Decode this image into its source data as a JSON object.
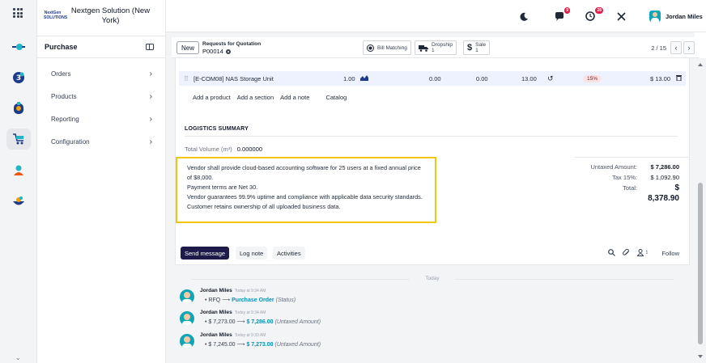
{
  "company": {
    "name": "Nextgen Solution (New York)",
    "logo_text": "NextGen SOLUTIONS"
  },
  "rail": {
    "apps": [
      {
        "name": "discuss-app-icon"
      },
      {
        "name": "todo-app-icon"
      },
      {
        "name": "contacts-app-icon"
      },
      {
        "name": "purchase-app-icon"
      },
      {
        "name": "crm-app-icon"
      },
      {
        "name": "sales-app-icon"
      }
    ],
    "more": "⌄"
  },
  "sidebar": {
    "title": "Purchase",
    "items": [
      {
        "label": "Orders"
      },
      {
        "label": "Products"
      },
      {
        "label": "Reporting"
      },
      {
        "label": "Configuration"
      }
    ]
  },
  "topbar": {
    "chat_count": "9",
    "activity_count": "28",
    "user_name": "Jordan Miles"
  },
  "control": {
    "new_label": "New",
    "breadcrumb_parent": "Requests for Quotation",
    "record_name": "P00014",
    "smart_buttons": [
      {
        "icon": "bill-matching-icon",
        "label": "Bill Matching",
        "value": ""
      },
      {
        "icon": "truck-icon",
        "label": "Dropship",
        "value": "1"
      },
      {
        "icon": "dollar-icon",
        "label": "Sale",
        "value": "1"
      }
    ],
    "pager": "2 / 15"
  },
  "order_line": {
    "product": "[E-COM08] NAS Storage Unit",
    "quantity": "1.00",
    "col_a": "0.00",
    "col_b": "0.00",
    "unit_price": "13.00",
    "tax": "15%",
    "subtotal": "$ 13.00"
  },
  "line_actions": [
    "Add a product",
    "Add a section",
    "Add a note",
    "Catalog"
  ],
  "logistics": {
    "title": "LOGISTICS SUMMARY",
    "volume_label": "Total Volume (m³)",
    "volume_value": "0.000000"
  },
  "notes": [
    "Vendor shall provide cloud-based accounting software for 25 users at a fixed annual price of $8,000.",
    "Payment terms are Net 30.",
    "Vendor guarantees 99.9% uptime and compliance with applicable data security standards.",
    "Customer retains ownership of all uploaded business data."
  ],
  "totals": {
    "untaxed_label": "Untaxed Amount:",
    "untaxed_value": "$ 7,286.00",
    "tax_label": "Tax 15%:",
    "tax_value": "$ 1,092.90",
    "total_label": "Total:",
    "total_value": "$ 8,378.90"
  },
  "chatter": {
    "send_message": "Send message",
    "log_note": "Log note",
    "activities": "Activities",
    "follower_count": "1",
    "follow": "Follow",
    "day_label": "Today",
    "messages": [
      {
        "author": "Jordan Miles",
        "time": "Today at 9:34 AM",
        "old": "RFQ",
        "new": "Purchase Order",
        "field": "(Status)"
      },
      {
        "author": "Jordan Miles",
        "time": "Today at 9:34 AM",
        "old": "$ 7,273.00",
        "new": "$ 7,286.00",
        "field": "(Untaxed Amount)"
      },
      {
        "author": "Jordan Miles",
        "time": "Today at 9:33 AM",
        "old": "$ 7,245.00",
        "new": "$ 7,273.00",
        "field": "(Untaxed Amount)"
      }
    ]
  },
  "colors": {
    "highlight": "#f2c513",
    "primary": "#1e1b4b",
    "accent": "#0891b2",
    "row_bg": "#eef2ff"
  }
}
